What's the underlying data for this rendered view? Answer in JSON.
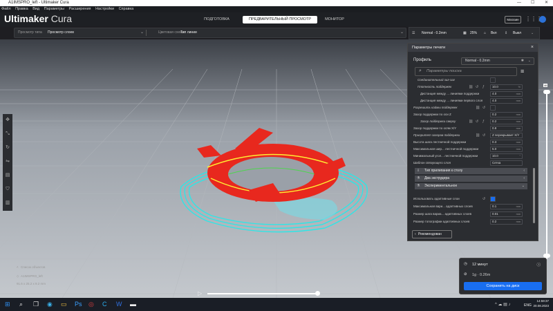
{
  "window": {
    "title": "A1IMSPRO_left - Ultimaker Cura",
    "controls": [
      "—",
      "☐",
      "✕"
    ]
  },
  "menu": [
    "Файл",
    "Правка",
    "Вид",
    "Параметры",
    "Расширения",
    "Настройки",
    "Справка"
  ],
  "header": {
    "logo_bold": "Ultimaker",
    "logo_light": "Cura",
    "stages": [
      "ПОДГОТОВКА",
      "ПРЕДВАРИТЕЛЬНЫЙ ПРОСМОТР",
      "МОНИТОР"
    ],
    "active_stage": "ПРЕДВАРИТЕЛЬНЫЙ ПРОСМОТР",
    "marketplace": "Магазин"
  },
  "view_bar": {
    "view_type_label": "Просмотр типа",
    "view_type_value": "Просмотр слоев",
    "color_scheme_label": "Цветовая схема",
    "color_scheme_value": "Тип линии"
  },
  "print_bar": {
    "profile": "Normal - 0.2mm",
    "infill": "25%",
    "support": "Вкл",
    "adhesion": "Выкл"
  },
  "panel": {
    "title": "Параметры печати",
    "profile_label": "Профиль",
    "profile_value": "Normal - 0.2mm",
    "search_placeholder": "Параметры поиска",
    "rows": [
      {
        "name": "Соединительный зиг-заг",
        "value": "",
        "unit": ""
      },
      {
        "name": "Плотность поддержек",
        "value": "10.0",
        "unit": "%"
      },
      {
        "name": "Дистанция между ... линиями поддержки",
        "value": "4.0",
        "unit": "mm"
      },
      {
        "name": "Дистанция между ... линиями первого слоя",
        "value": "4.0",
        "unit": "mm"
      },
      {
        "name": "Разрешить каймы поддержек",
        "value": "",
        "unit": ""
      },
      {
        "name": "Зазор поддержки по оси Z",
        "value": "0.2",
        "unit": "mm"
      },
      {
        "name": "Зазор поддержки сверху",
        "value": "0.2",
        "unit": "mm"
      },
      {
        "name": "Зазор поддержки по осям X/Y",
        "value": "0.8",
        "unit": "mm"
      },
      {
        "name": "Приоритет зазоров поддержки",
        "value": "Z перекрывает X/Y",
        "unit": ""
      },
      {
        "name": "Высота шага лестничной поддержки",
        "value": "0.3",
        "unit": "mm"
      },
      {
        "name": "Максимальная шир... лестничной поддержки",
        "value": "5.0",
        "unit": "mm"
      },
      {
        "name": "Минимальный угол... лестничной поддержки",
        "value": "10.0",
        "unit": "°"
      },
      {
        "name": "Шаблон связующего слоя",
        "value": "Сетка",
        "unit": ""
      }
    ],
    "categories": [
      "Тип прилипания к столу",
      "Два экструдера",
      "Экспериментальное"
    ],
    "rows2": [
      {
        "name": "Использовать адаптивные слои",
        "value": "",
        "unit": ""
      },
      {
        "name": "Максимальная вари... адаптивных слоев",
        "value": "0.1",
        "unit": "mm"
      },
      {
        "name": "Размер шага вариа... адаптивных слоев",
        "value": "0.01",
        "unit": "mm"
      },
      {
        "name": "Размер топографии адаптивных слоев",
        "value": "0.2",
        "unit": "mm"
      }
    ],
    "recommend_button": "Рекомендован"
  },
  "layer_slider": {
    "value": "46"
  },
  "objects": {
    "list_label": "Список объектов",
    "model_name": "A1IMSPRO_left",
    "dimensions": "91.6 x 25.2 x 9.2 mm"
  },
  "print_card": {
    "time": "12 минут",
    "material": "1g · 0.26m",
    "save_button": "Сохранить на диск"
  },
  "taskbar": {
    "lang": "ENG",
    "time": "14:59:37",
    "date": "20.08.2023"
  },
  "colors": {
    "accent": "#196ef0",
    "wall_red": "#e8281e",
    "skirt_cyan": "#2ee6e6",
    "support_cyan": "#7fd6e0"
  }
}
